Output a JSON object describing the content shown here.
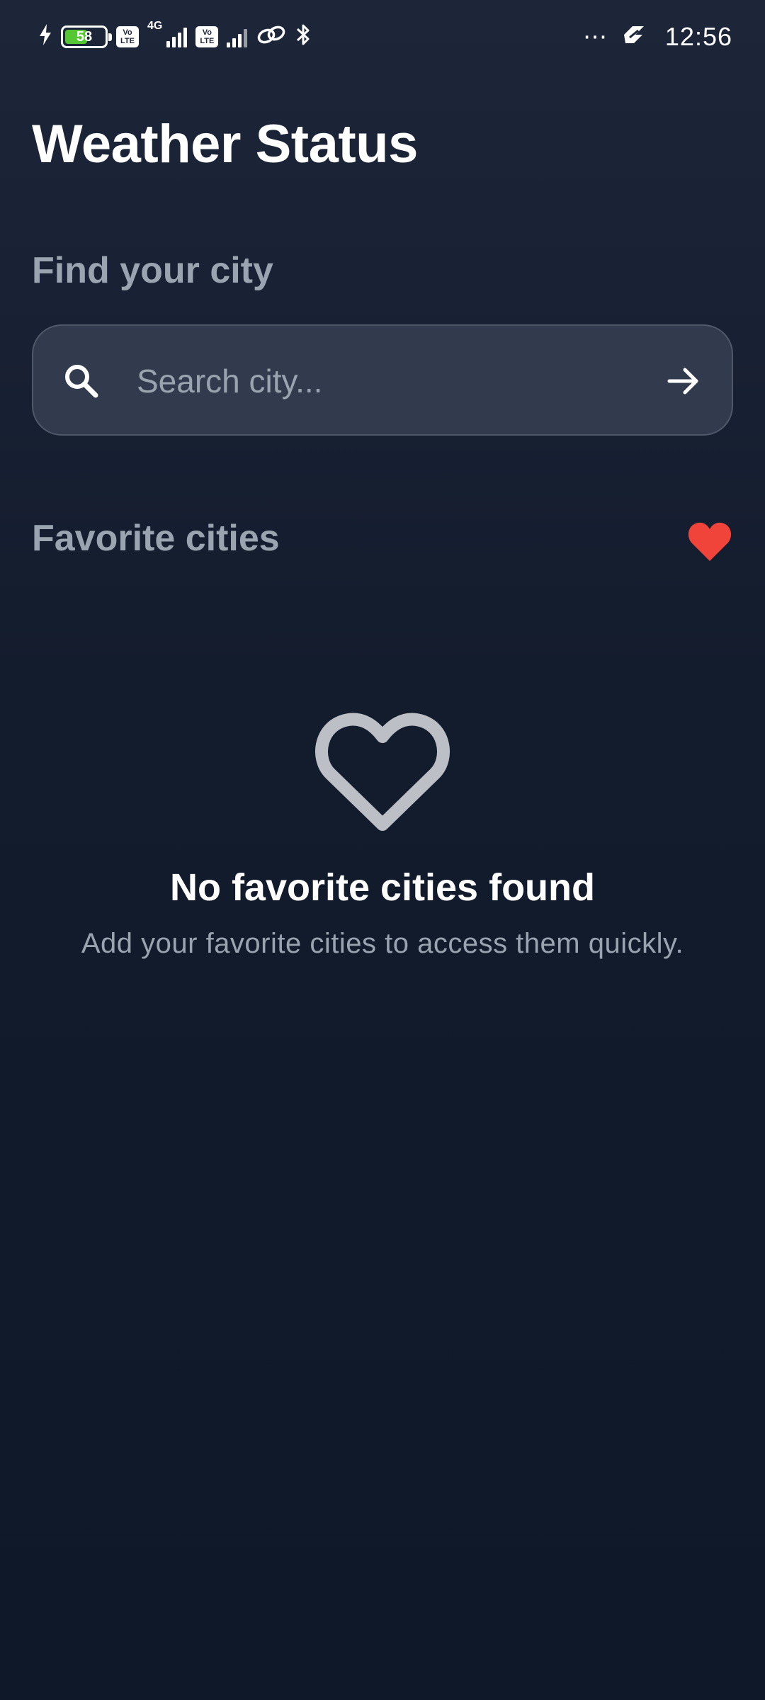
{
  "status_bar": {
    "battery_level": "58",
    "battery_fraction": 0.58,
    "network_type": "4G",
    "volte_label_top": "Vo",
    "volte_label_bottom": "LTE",
    "time": "12:56",
    "icons": [
      "charging-bolt-icon",
      "battery-icon",
      "volte-icon",
      "signal-icon",
      "link-icon",
      "bluetooth-icon",
      "more-dots-icon",
      "data-saver-icon"
    ]
  },
  "header": {
    "title": "Weather Status"
  },
  "search": {
    "section_label": "Find your city",
    "placeholder": "Search city...",
    "value": "",
    "icon": "search-icon",
    "submit_icon": "arrow-right-icon"
  },
  "favorites": {
    "section_label": "Favorite cities",
    "badge_icon": "heart-icon",
    "badge_color": "#f0443a",
    "empty_icon": "heart-outline-icon",
    "empty_title": "No favorite cities found",
    "empty_subtitle": "Add your favorite cities to access them quickly."
  },
  "colors": {
    "background_top": "#1d2639",
    "background_bottom": "#0e1828",
    "search_field": "#323b4d",
    "muted_text": "#9aa3b0",
    "battery_fill": "#55c733"
  }
}
